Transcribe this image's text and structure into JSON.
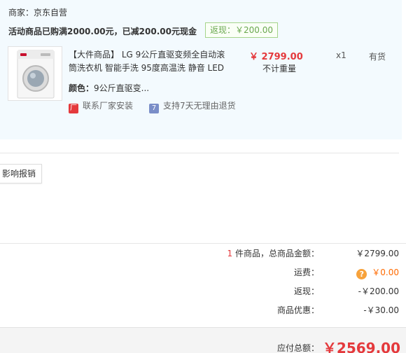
{
  "order": {
    "merchant": "商家：京东自营",
    "promo": "活动商品已购满2000.00元，已减200.00元现金",
    "cashback_tag": "返现：￥200.00",
    "item": {
      "title": "【大件商品】 LG 9公斤直驱变频全自动滚筒洗衣机 智能手洗 95度高温洗 静音 LED",
      "color_label": "颜色：",
      "color_value": "9公斤直驱变...",
      "price": "￥ 2799.00",
      "weight_note": "不计重量",
      "quantity": "x1",
      "stock": "有货",
      "service_install": "联系厂家安装",
      "service_return": "支持7天无理由退货",
      "image_icon": "washing-machine-icon"
    }
  },
  "report_button": "影响报销",
  "summary": {
    "count": "1",
    "count_label": " 件商品，总商品金额：",
    "total_goods": "￥2799.00",
    "freight_label": "运费：",
    "freight_icon": "question-icon",
    "freight_value": "￥0.00",
    "cashback_label": "返现：",
    "cashback_value": "-￥200.00",
    "discount_label": "商品优惠：",
    "discount_value": "-￥30.00",
    "payable_label": "应付总额：",
    "payable_value": "￥2569.00"
  },
  "colors": {
    "price_red": "#e4393c",
    "cashback_green": "#6aa84f",
    "freight_orange": "#ff6a00",
    "panel_bg": "#f3fafe"
  }
}
